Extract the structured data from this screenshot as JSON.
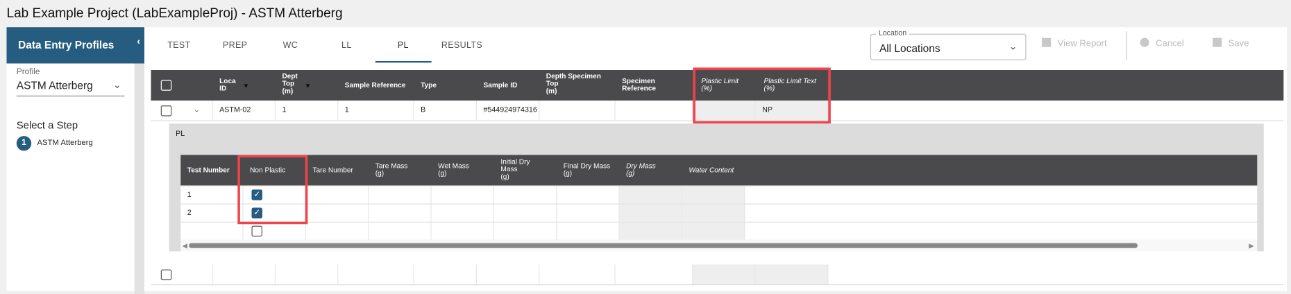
{
  "title": "Lab Example Project (LabExampleProj) - ASTM Atterberg",
  "sidebar": {
    "header": "Data Entry Profiles",
    "collapse": "‹",
    "profile_label": "Profile",
    "profile_value": "ASTM Atterberg",
    "step_title": "Select a Step",
    "steps": [
      {
        "num": "1",
        "label": "ASTM Atterberg"
      }
    ]
  },
  "tabs": [
    "TEST",
    "PREP",
    "WC",
    "LL",
    "PL",
    "RESULTS"
  ],
  "active_tab": "PL",
  "location": {
    "label": "Location",
    "value": "All Locations"
  },
  "toolbar": {
    "view_report": "View Report",
    "cancel": "Cancel",
    "save": "Save"
  },
  "grid": {
    "headers": [
      "Loca\nID",
      "Dept\nTop\n(m)",
      "Sample Reference",
      "Type",
      "Sample ID",
      "Depth Specimen\nTop\n(m)",
      "Specimen\nReference",
      "Plastic Limit\n(%)",
      "Plastic Limit Text\n(%)"
    ],
    "rows": [
      {
        "loca_id": "ASTM-02",
        "depth_top": "1",
        "sample_ref": "1",
        "type": "B",
        "sample_id": "#544924974316",
        "depth_spec": "",
        "spec_ref": "",
        "pl": "",
        "pl_text": "NP"
      }
    ]
  },
  "detail": {
    "title": "PL",
    "headers": [
      "Test Number",
      "Non Plastic",
      "Tare Number",
      "Tare Mass\n(g)",
      "Wet Mass\n(g)",
      "Initial Dry\nMass\n(g)",
      "Final Dry Mass\n(g)",
      "Dry Mass\n(g)",
      "Water Content"
    ],
    "rows": [
      {
        "test_number": "1",
        "non_plastic": true
      },
      {
        "test_number": "2",
        "non_plastic": true
      },
      {
        "test_number": "",
        "non_plastic": false
      }
    ]
  },
  "colors": {
    "brand": "#255c80",
    "header": "#4a4a4c",
    "highlight": "#f0434a"
  }
}
